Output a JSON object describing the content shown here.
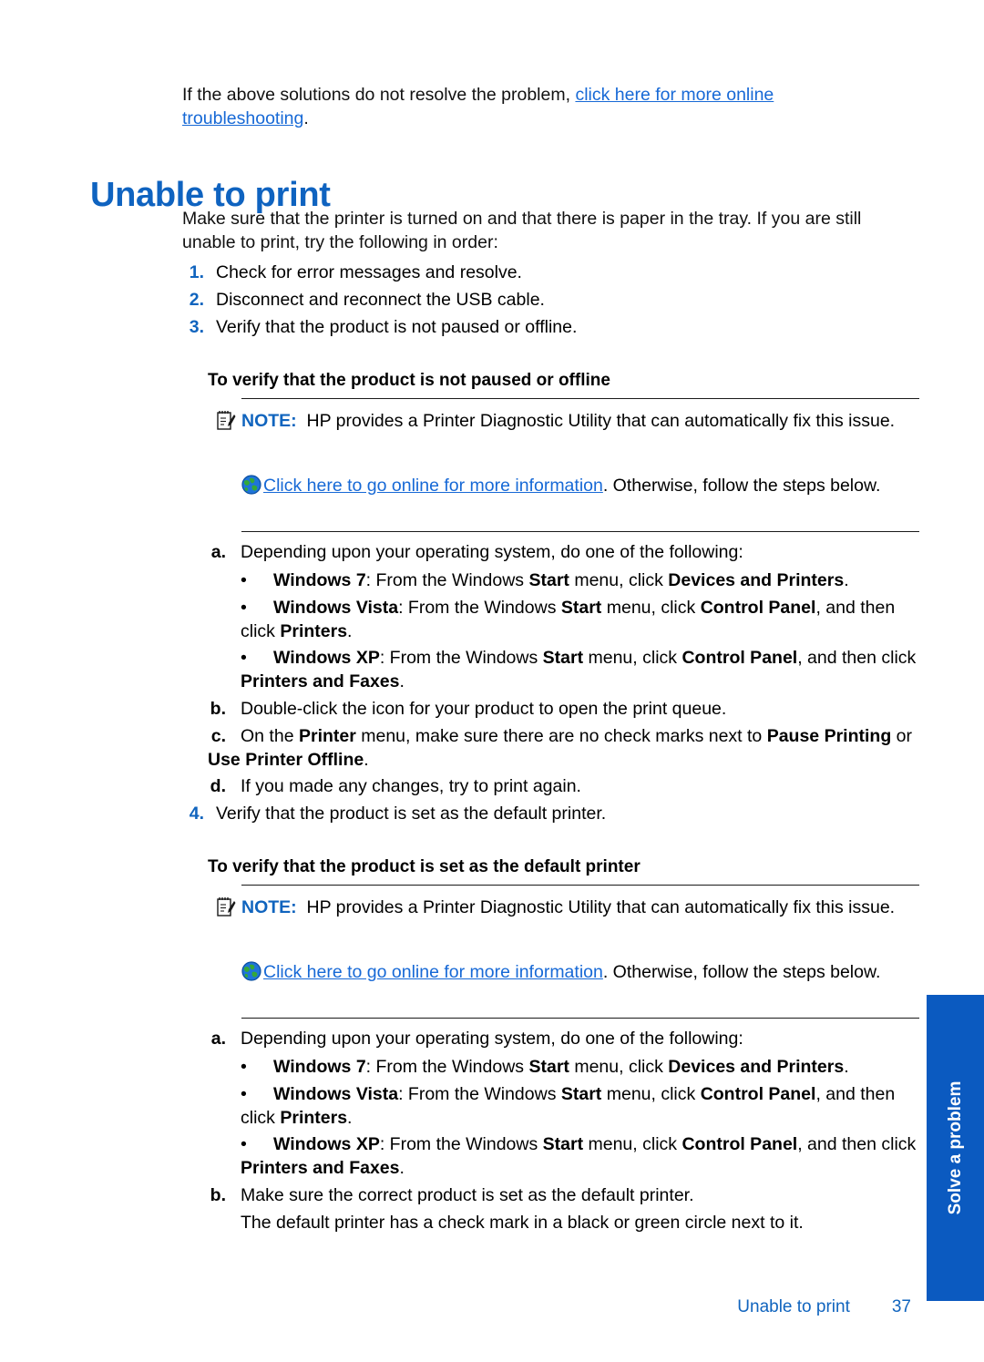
{
  "intro": {
    "text_before": "If the above solutions do not resolve the problem, ",
    "link": "click here for more online troubleshooting",
    "text_after": "."
  },
  "page_title": "Unable to print",
  "lead": "Make sure that the printer is turned on and that there is paper in the tray. If you are still unable to print, try the following in order:",
  "numbered_steps": [
    {
      "marker": "1.",
      "text": "Check for error messages and resolve."
    },
    {
      "marker": "2.",
      "text": "Disconnect and reconnect the USB cable."
    },
    {
      "marker": "3.",
      "text": "Verify that the product is not paused or offline."
    },
    {
      "marker": "4.",
      "text": "Verify that the product is set as the default printer."
    }
  ],
  "section1": {
    "title": "To verify that the product is not paused or offline",
    "note": {
      "icon": "note-pencil-icon",
      "label": "NOTE:",
      "text": "HP provides a Printer Diagnostic Utility that can automatically fix this issue."
    },
    "online": {
      "icon": "globe-icon",
      "link": "Click here to go online for more information",
      "text_after": ". Otherwise, follow the steps below."
    },
    "steps": [
      {
        "marker": "a.",
        "text": "Depending upon your operating system, do one of the following:"
      },
      {
        "marker": "b.",
        "text": "Double-click the icon for your product to open the print queue."
      },
      {
        "marker": "c.",
        "parts": [
          {
            "t": "On the ",
            "b": false
          },
          {
            "t": "Printer",
            "b": true
          },
          {
            "t": " menu, make sure there are no check marks next to ",
            "b": false
          },
          {
            "t": "Pause Printing",
            "b": true
          },
          {
            "t": " or ",
            "b": false
          },
          {
            "t": "Use Printer Offline",
            "b": true
          },
          {
            "t": ".",
            "b": false
          }
        ]
      },
      {
        "marker": "d.",
        "text": "If you made any changes, try to print again."
      }
    ],
    "bullets": [
      {
        "marker": "•",
        "parts": [
          {
            "t": "Windows 7",
            "b": true
          },
          {
            "t": ": From the Windows ",
            "b": false
          },
          {
            "t": "Start",
            "b": true
          },
          {
            "t": " menu, click ",
            "b": false
          },
          {
            "t": "Devices and Printers",
            "b": true
          },
          {
            "t": ".",
            "b": false
          }
        ]
      },
      {
        "marker": "•",
        "parts": [
          {
            "t": "Windows Vista",
            "b": true
          },
          {
            "t": ": From the Windows ",
            "b": false
          },
          {
            "t": "Start",
            "b": true
          },
          {
            "t": " menu, click ",
            "b": false
          },
          {
            "t": "Control Panel",
            "b": true
          },
          {
            "t": ", and then click ",
            "b": false
          },
          {
            "t": "Printers",
            "b": true
          },
          {
            "t": ".",
            "b": false
          }
        ]
      },
      {
        "marker": "•",
        "parts": [
          {
            "t": "Windows XP",
            "b": true
          },
          {
            "t": ": From the Windows ",
            "b": false
          },
          {
            "t": "Start",
            "b": true
          },
          {
            "t": " menu, click ",
            "b": false
          },
          {
            "t": "Control Panel",
            "b": true
          },
          {
            "t": ", and then click ",
            "b": false
          },
          {
            "t": "Printers and Faxes",
            "b": true
          },
          {
            "t": ".",
            "b": false
          }
        ]
      }
    ]
  },
  "section2": {
    "title": "To verify that the product is set as the default printer",
    "note": {
      "icon": "note-pencil-icon",
      "label": "NOTE:",
      "text": "HP provides a Printer Diagnostic Utility that can automatically fix this issue."
    },
    "online": {
      "icon": "globe-icon",
      "link": "Click here to go online for more information",
      "text_after": ". Otherwise, follow the steps below."
    },
    "steps": [
      {
        "marker": "a.",
        "text": "Depending upon your operating system, do one of the following:"
      },
      {
        "marker": "b.",
        "text": "Make sure the correct product is set as the default printer."
      }
    ],
    "closing": "The default printer has a check mark in a black or green circle next to it.",
    "bullets": [
      {
        "marker": "•",
        "parts": [
          {
            "t": "Windows 7",
            "b": true
          },
          {
            "t": ": From the Windows ",
            "b": false
          },
          {
            "t": "Start",
            "b": true
          },
          {
            "t": " menu, click ",
            "b": false
          },
          {
            "t": "Devices and Printers",
            "b": true
          },
          {
            "t": ".",
            "b": false
          }
        ]
      },
      {
        "marker": "•",
        "parts": [
          {
            "t": "Windows Vista",
            "b": true
          },
          {
            "t": ": From the Windows ",
            "b": false
          },
          {
            "t": "Start",
            "b": true
          },
          {
            "t": " menu, click ",
            "b": false
          },
          {
            "t": "Control Panel",
            "b": true
          },
          {
            "t": ", and then click ",
            "b": false
          },
          {
            "t": "Printers",
            "b": true
          },
          {
            "t": ".",
            "b": false
          }
        ]
      },
      {
        "marker": "•",
        "parts": [
          {
            "t": "Windows XP",
            "b": true
          },
          {
            "t": ": From the Windows ",
            "b": false
          },
          {
            "t": "Start",
            "b": true
          },
          {
            "t": " menu, click ",
            "b": false
          },
          {
            "t": "Control Panel",
            "b": true
          },
          {
            "t": ", and then click ",
            "b": false
          },
          {
            "t": "Printers and Faxes",
            "b": true
          },
          {
            "t": ".",
            "b": false
          }
        ]
      }
    ]
  },
  "side_tab": {
    "label": "Solve a problem"
  },
  "footer": {
    "title": "Unable to print",
    "page_number": "37"
  },
  "colors": {
    "heading_blue": "#0F63C0",
    "link_blue": "#1769D6",
    "marker_blue": "#1064BE",
    "tab_blue": "#0B5AC0"
  }
}
